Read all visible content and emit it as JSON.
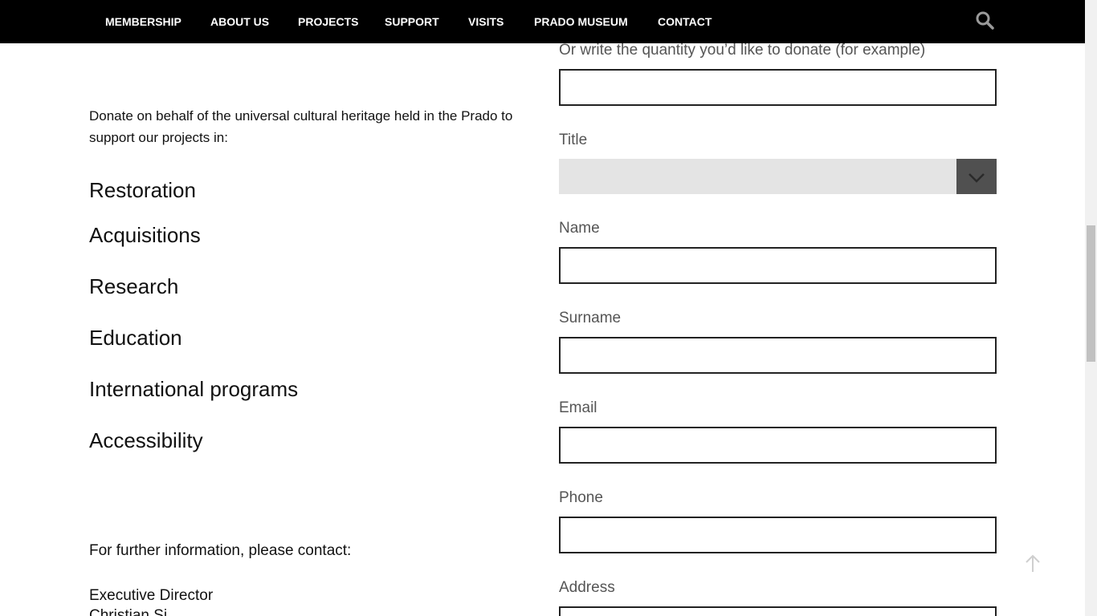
{
  "nav": {
    "items": [
      "MEMBERSHIP",
      "ABOUT US",
      "PROJECTS",
      "SUPPORT",
      "VISITS",
      "PRADO MUSEUM",
      "CONTACT"
    ],
    "search_icon": "search-icon"
  },
  "left": {
    "intro": "Donate on behalf of the universal cultural heritage held in the Prado to support our projects in:",
    "projects": [
      "Restoration",
      "Acquisitions",
      "Research",
      "Education",
      "International programs",
      "Accessibility"
    ],
    "contact_intro": "For further information, please contact:",
    "contact_role": "Executive Director",
    "contact_name": "Christian Si..."
  },
  "form": {
    "quantity_label": "Or write the quantity you’d like to donate (for example)",
    "quantity_value": "",
    "title_label": "Title",
    "title_selected": "",
    "name_label": "Name",
    "name_value": "",
    "surname_label": "Surname",
    "surname_value": "",
    "email_label": "Email",
    "email_value": "",
    "phone_label": "Phone",
    "phone_value": "",
    "address_label": "Address",
    "address_value": ""
  },
  "icons": {
    "select_arrow": "chevron-down-icon",
    "back_to_top": "arrow-up-icon"
  },
  "colors": {
    "nav_bg": "#000000",
    "nav_text": "#ffffff",
    "select_bg": "#e4e4e4",
    "select_arrow_bg": "#505050"
  }
}
